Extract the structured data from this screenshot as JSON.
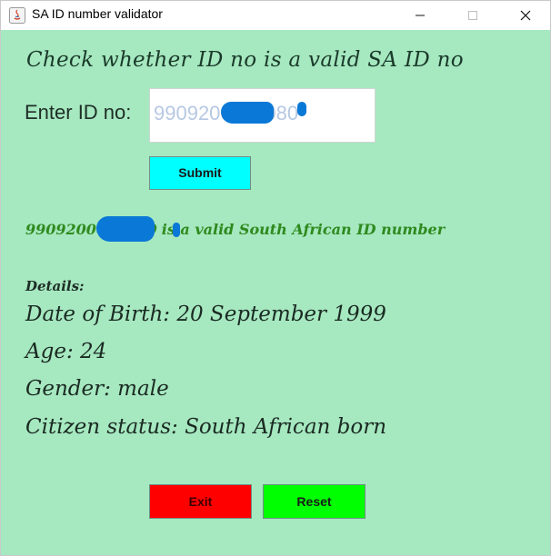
{
  "window": {
    "title": "SA ID number validator"
  },
  "main": {
    "heading": "Check whether ID no is a valid SA ID no",
    "id_label": "Enter ID no:",
    "id_value": "9909200000080",
    "submit_label": "Submit",
    "result_id": "9909200000080",
    "result_text": "is a valid South African ID number",
    "details_label": "Details:",
    "details": {
      "dob": "Date of Birth: 20 September 1999",
      "age": "Age: 24",
      "gender": "Gender: male",
      "citizen": "Citizen status: South African born"
    },
    "exit_label": "Exit",
    "reset_label": "Reset"
  },
  "colors": {
    "background": "#a6e8c0",
    "submit": "#00ffff",
    "exit": "#ff0000",
    "reset": "#00ff00",
    "result_text": "#2f8a1e",
    "redaction": "#0a78d6"
  }
}
